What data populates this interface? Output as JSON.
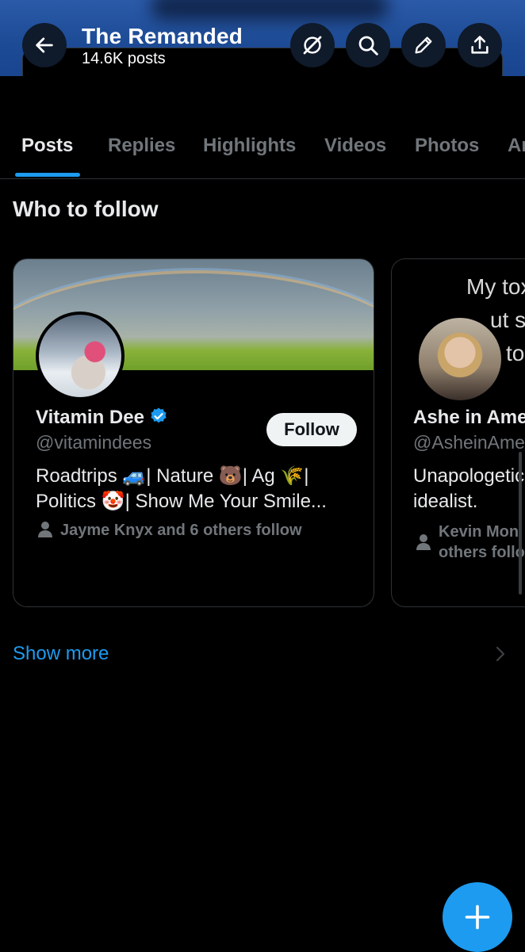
{
  "header": {
    "title": "The Remanded",
    "post_count": "14.6K posts",
    "background": "#1c4a94"
  },
  "tabs": [
    {
      "label": "Posts",
      "active": true
    },
    {
      "label": "Replies",
      "active": false
    },
    {
      "label": "Highlights",
      "active": false
    },
    {
      "label": "Videos",
      "active": false
    },
    {
      "label": "Photos",
      "active": false
    },
    {
      "label": "Ar",
      "active": false
    }
  ],
  "who_to_follow": {
    "title": "Who to follow",
    "cards": [
      {
        "name": "Vitamin Dee",
        "verified": true,
        "handle": "@vitamindees",
        "follow_label": "Follow",
        "bio_line1": "Roadtrips 🚙| Nature 🐻| Ag 🌾|",
        "bio_line2": "Politics 🤡| Show Me Your Smile...",
        "followed_by": "Jayme Knyx and 6 others follow"
      },
      {
        "banner_text_line1": "My tox",
        "banner_text_line2": "ut so",
        "banner_text_line3": "to",
        "name": "Ashe in Ame",
        "handle": "@AsheinAme",
        "bio_line1": "Unapologetic",
        "bio_line2": "idealist.",
        "followed_by_line1": "Kevin Mon",
        "followed_by_line2": "others follo"
      }
    ],
    "show_more": "Show more"
  },
  "colors": {
    "accent": "#1d9bf0",
    "background": "#000000",
    "muted_text": "#71767b"
  }
}
